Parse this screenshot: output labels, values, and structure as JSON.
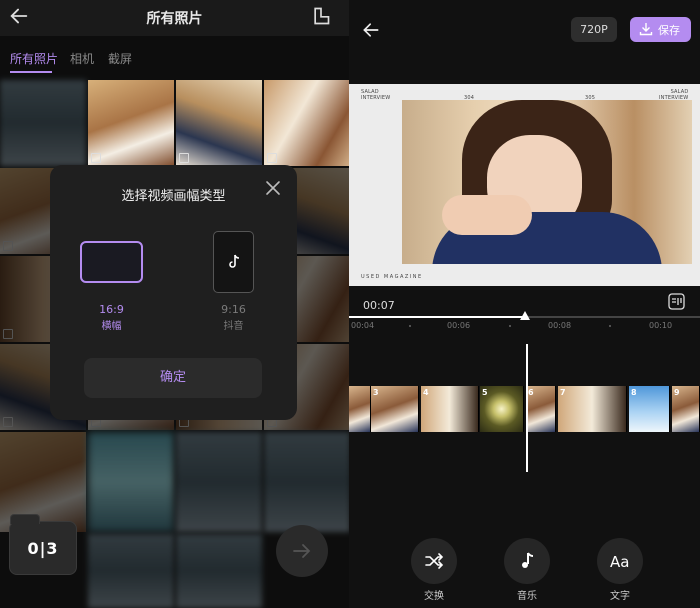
{
  "left": {
    "title": "所有照片",
    "tabs": [
      {
        "label": "所有照片",
        "active": true
      },
      {
        "label": "相机",
        "active": false
      },
      {
        "label": "截屏",
        "active": false
      }
    ],
    "dialog": {
      "title": "选择视频画幅类型",
      "options": [
        {
          "ratio": "16:9",
          "label": "横幅",
          "selected": true
        },
        {
          "ratio": "9:16",
          "label": "抖音",
          "selected": false
        }
      ],
      "confirm_label": "确定"
    },
    "selection_counter": "0|3"
  },
  "right": {
    "resolution_label": "720P",
    "save_label": "保存",
    "preview": {
      "text_top_left": "SALAD\nINTERVIEW",
      "text_top_right": "SALAD\nINTERVIEW",
      "page_left": "304",
      "page_right": "305",
      "text_bottom": "USED MAGAZINE"
    },
    "current_time": "00:07",
    "progress": 0.5,
    "ruler_ticks": [
      "00:04",
      "00:06",
      "00:08",
      "00:10"
    ],
    "clips": [
      "3",
      "4",
      "5",
      "6",
      "7",
      "8",
      "9"
    ],
    "tools": [
      {
        "label": "交换",
        "icon": "shuffle-icon"
      },
      {
        "label": "音乐",
        "icon": "music-note-icon"
      },
      {
        "label": "文字",
        "icon": "text-aa-icon"
      }
    ]
  },
  "colors": {
    "accent": "#b48cf0",
    "background": "#111111",
    "panel": "#1f1f1f"
  }
}
